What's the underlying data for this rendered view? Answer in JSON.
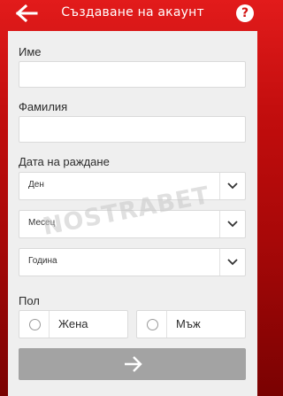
{
  "header": {
    "title": "Създаване на акаунт",
    "help_label": "?"
  },
  "form": {
    "first_name_label": "Име",
    "first_name_value": "",
    "last_name_label": "Фамилия",
    "last_name_value": "",
    "dob_label": "Дата на раждане",
    "day_selected": "Ден",
    "month_selected": "Месец",
    "year_selected": "Година",
    "gender_label": "Пол",
    "gender_female": "Жена",
    "gender_male": "Мъж"
  },
  "watermark": "NOSTRABET",
  "colors": {
    "accent": "#d21212",
    "card": "#efefef",
    "submit_disabled": "#a3a3a3"
  }
}
